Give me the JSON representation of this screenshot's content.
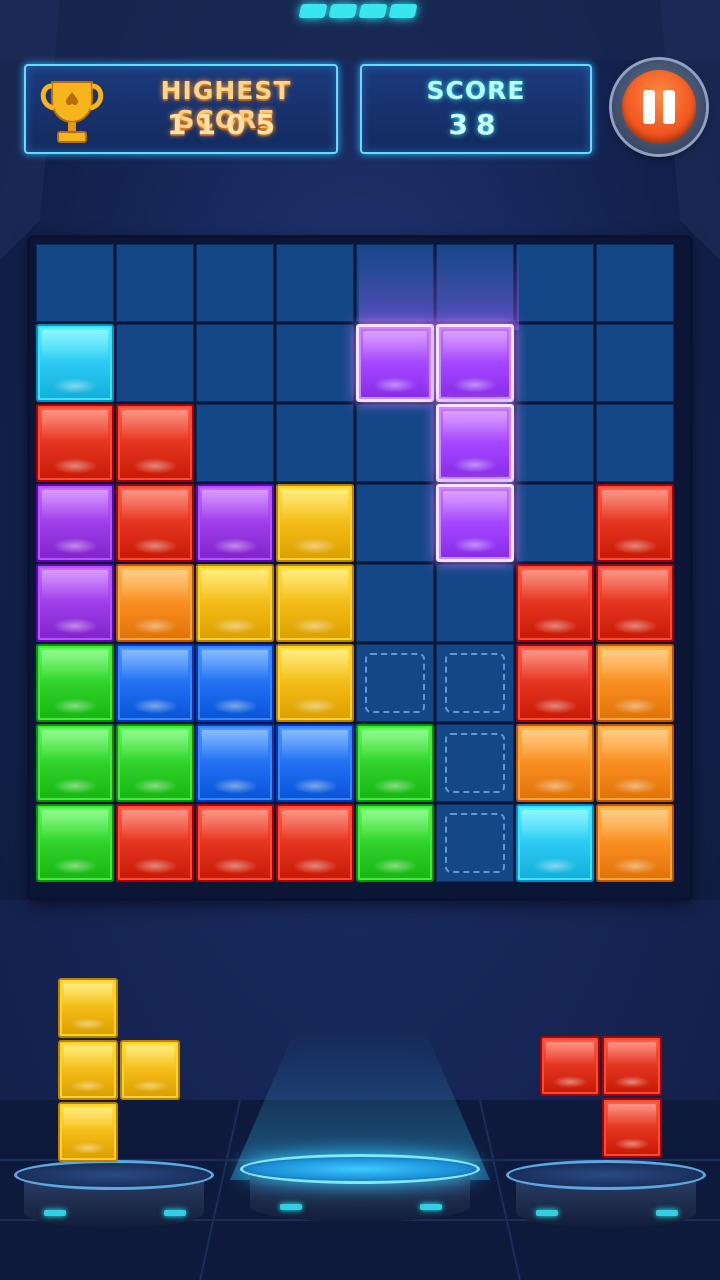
{
  "header": {
    "highest_score_label": "HIGHEST SCORE",
    "highest_score_value": "1105",
    "score_label": "SCORE",
    "score_value": "38",
    "pause_icon": "pause-icon",
    "trophy_icon": "trophy-icon"
  },
  "colors": {
    "cyan": "#29c7f2",
    "red": "#e0321c",
    "purple": "#9a3be6",
    "yellow": "#f2b814",
    "orange": "#f78b1f",
    "green": "#2dcf28",
    "blue": "#1f6df0",
    "active": "#a044ff"
  },
  "board": {
    "rows": 8,
    "cols": 8,
    "grid": [
      [
        "",
        "",
        "",
        "",
        "",
        "",
        "",
        ""
      ],
      [
        "cyan",
        "",
        "",
        "",
        "",
        "",
        "",
        ""
      ],
      [
        "red",
        "red",
        "",
        "",
        "",
        "",
        "",
        ""
      ],
      [
        "purple",
        "red",
        "purple",
        "yellow",
        "",
        "",
        "",
        "red"
      ],
      [
        "purple",
        "orange",
        "yellow",
        "yellow",
        "",
        "",
        "red",
        "red"
      ],
      [
        "green",
        "blue",
        "blue",
        "yellow",
        "hole",
        "hole",
        "red",
        "orange"
      ],
      [
        "green",
        "green",
        "blue",
        "blue",
        "green",
        "hole",
        "orange",
        "orange"
      ],
      [
        "green",
        "red",
        "red",
        "red",
        "green",
        "hole",
        "cyan",
        "orange"
      ]
    ],
    "active_piece": {
      "color": "active",
      "cells": [
        [
          1,
          4
        ],
        [
          1,
          5
        ],
        [
          2,
          5
        ],
        [
          3,
          5
        ]
      ]
    }
  },
  "tray": {
    "pieces": [
      {
        "color": "yellow",
        "cells": [
          [
            0,
            0
          ],
          [
            1,
            0
          ],
          [
            1,
            1
          ],
          [
            2,
            0
          ]
        ]
      },
      {
        "color": "red",
        "cells": [
          [
            0,
            0
          ],
          [
            0,
            1
          ],
          [
            1,
            1
          ]
        ]
      }
    ]
  }
}
